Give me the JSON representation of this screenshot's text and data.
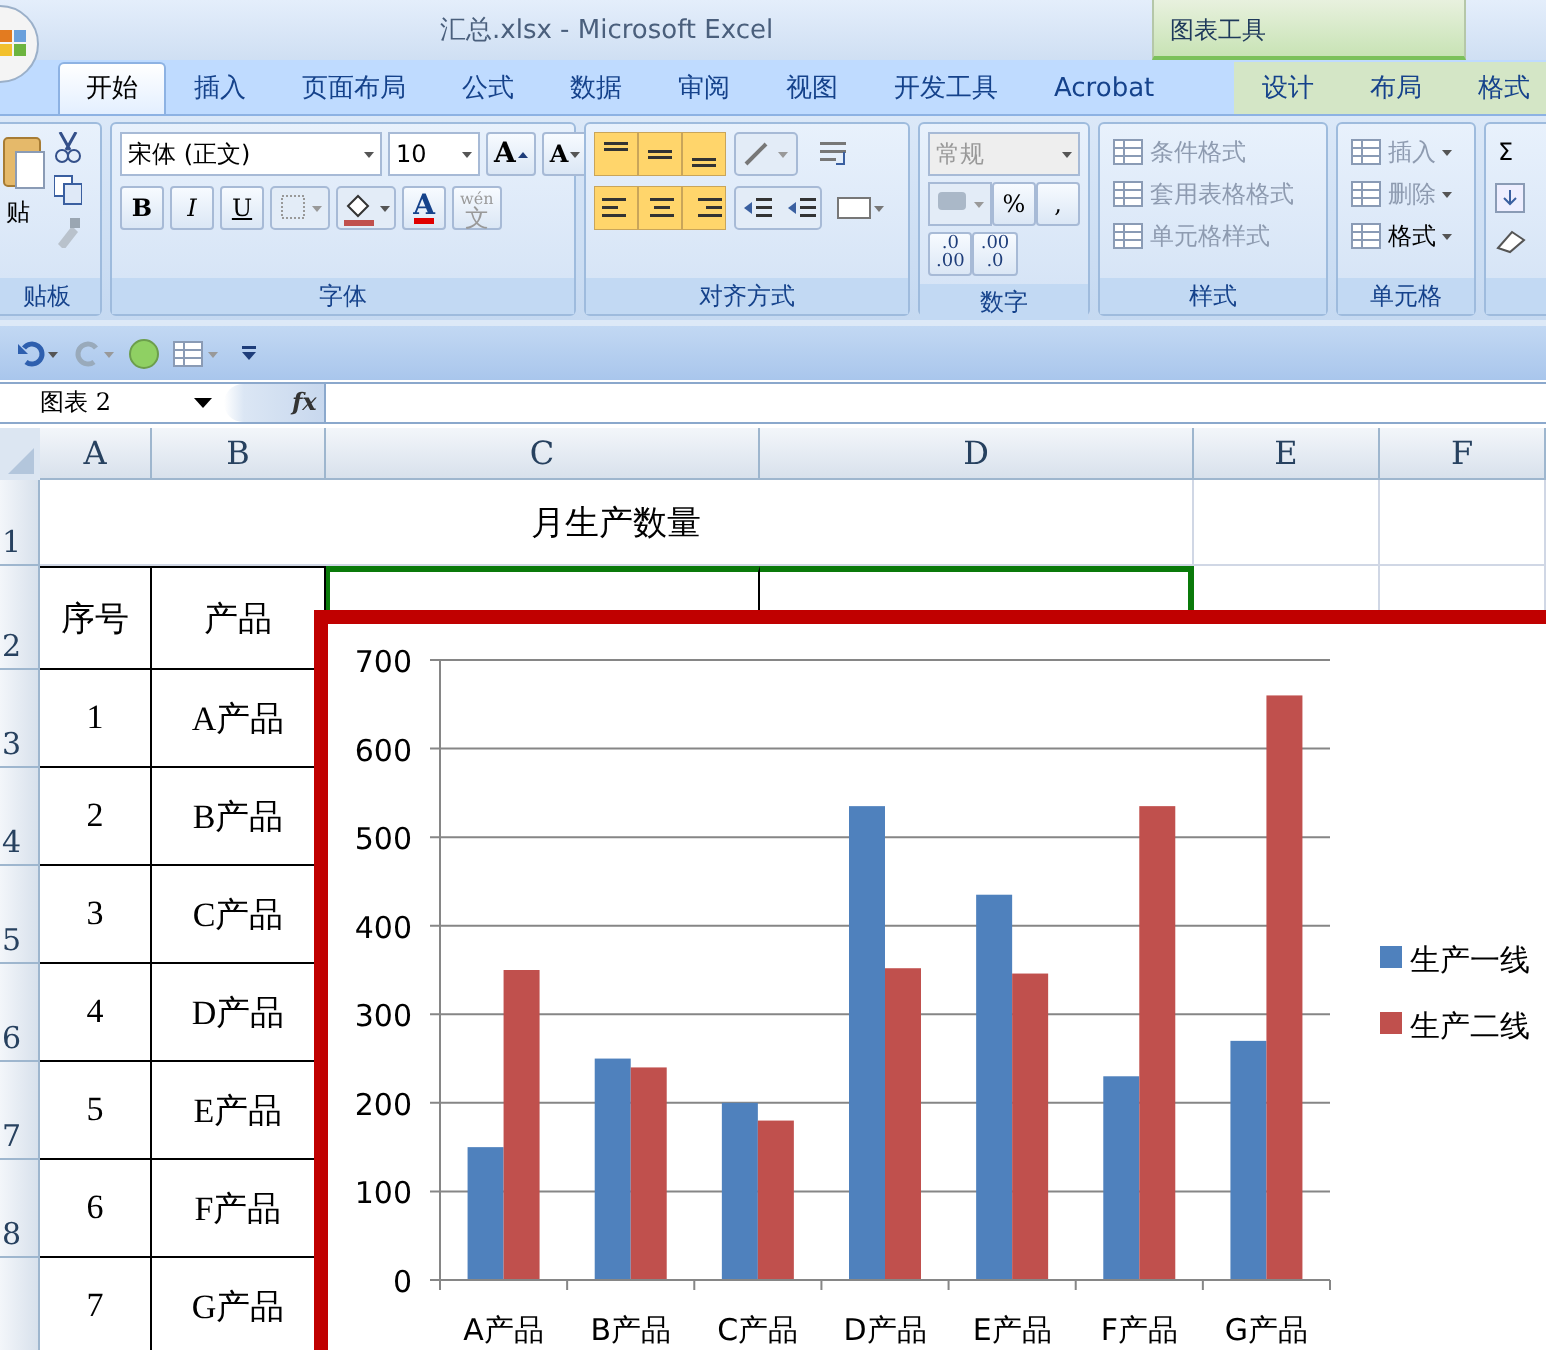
{
  "window": {
    "title": "汇总.xlsx - Microsoft Excel"
  },
  "contextual_tab_group": {
    "label": "图表工具"
  },
  "tabs": [
    {
      "label": "开始",
      "selected": true,
      "contextual": false
    },
    {
      "label": "插入",
      "selected": false,
      "contextual": false
    },
    {
      "label": "页面布局",
      "selected": false,
      "contextual": false
    },
    {
      "label": "公式",
      "selected": false,
      "contextual": false
    },
    {
      "label": "数据",
      "selected": false,
      "contextual": false
    },
    {
      "label": "审阅",
      "selected": false,
      "contextual": false
    },
    {
      "label": "视图",
      "selected": false,
      "contextual": false
    },
    {
      "label": "开发工具",
      "selected": false,
      "contextual": false
    },
    {
      "label": "Acrobat",
      "selected": false,
      "contextual": false
    },
    {
      "label": "设计",
      "selected": false,
      "contextual": true
    },
    {
      "label": "布局",
      "selected": false,
      "contextual": true
    },
    {
      "label": "格式",
      "selected": false,
      "contextual": true
    }
  ],
  "ribbon": {
    "clipboard": {
      "label": "贴板",
      "paste": "贴"
    },
    "font": {
      "label": "字体",
      "font_name": "宋体 (正文)",
      "font_size": "10",
      "grow": "A",
      "shrink": "A",
      "bold": "B",
      "italic": "I",
      "underline": "U",
      "font_color": "A",
      "phonetic_top": "wén",
      "phonetic_char": "文"
    },
    "alignment": {
      "label": "对齐方式"
    },
    "number": {
      "label": "数字",
      "format": "常规",
      "percent": "%",
      "comma": ",",
      "increase_decimal": [
        ".0",
        ".00"
      ],
      "decrease_decimal": [
        ".00",
        ".0"
      ]
    },
    "styles": {
      "label": "样式",
      "items": [
        {
          "label": "条件格式",
          "disabled": true
        },
        {
          "label": "套用表格格式",
          "disabled": true
        },
        {
          "label": "单元格样式",
          "disabled": true
        }
      ]
    },
    "cells": {
      "label": "单元格",
      "items": [
        {
          "label": "插入",
          "disabled": true
        },
        {
          "label": "删除",
          "disabled": true
        },
        {
          "label": "格式",
          "disabled": false
        }
      ]
    },
    "editing": {
      "sum": "Σ"
    }
  },
  "formula_bar": {
    "name_box": "图表 2",
    "fx": "fx"
  },
  "sheet": {
    "column_headers": [
      "A",
      "B",
      "C",
      "D",
      "E",
      "F"
    ],
    "row_headers": [
      "1",
      "2",
      "3",
      "4",
      "5",
      "6",
      "7",
      "8"
    ],
    "title": "月生产数量",
    "header_row": [
      "序号",
      "产品"
    ],
    "data_rows": [
      [
        "1",
        "A产品"
      ],
      [
        "2",
        "B产品"
      ],
      [
        "3",
        "C产品"
      ],
      [
        "4",
        "D产品"
      ],
      [
        "5",
        "E产品"
      ],
      [
        "6",
        "F产品"
      ],
      [
        "7",
        "G产品"
      ]
    ]
  },
  "chart": {
    "chart_data": {
      "type": "bar",
      "categories": [
        "A产品",
        "B产品",
        "C产品",
        "D产品",
        "E产品",
        "F产品",
        "G产品"
      ],
      "series": [
        {
          "name": "生产一线",
          "color": "#4f81bd",
          "values": [
            150,
            250,
            200,
            535,
            435,
            230,
            270
          ]
        },
        {
          "name": "生产二线",
          "color": "#c0504d",
          "values": [
            350,
            240,
            180,
            352,
            346,
            535,
            660
          ]
        }
      ],
      "grid": true,
      "legend": true,
      "ylim": [
        0,
        700
      ],
      "yticks": [
        0,
        100,
        200,
        300,
        400,
        500,
        600,
        700
      ]
    }
  }
}
